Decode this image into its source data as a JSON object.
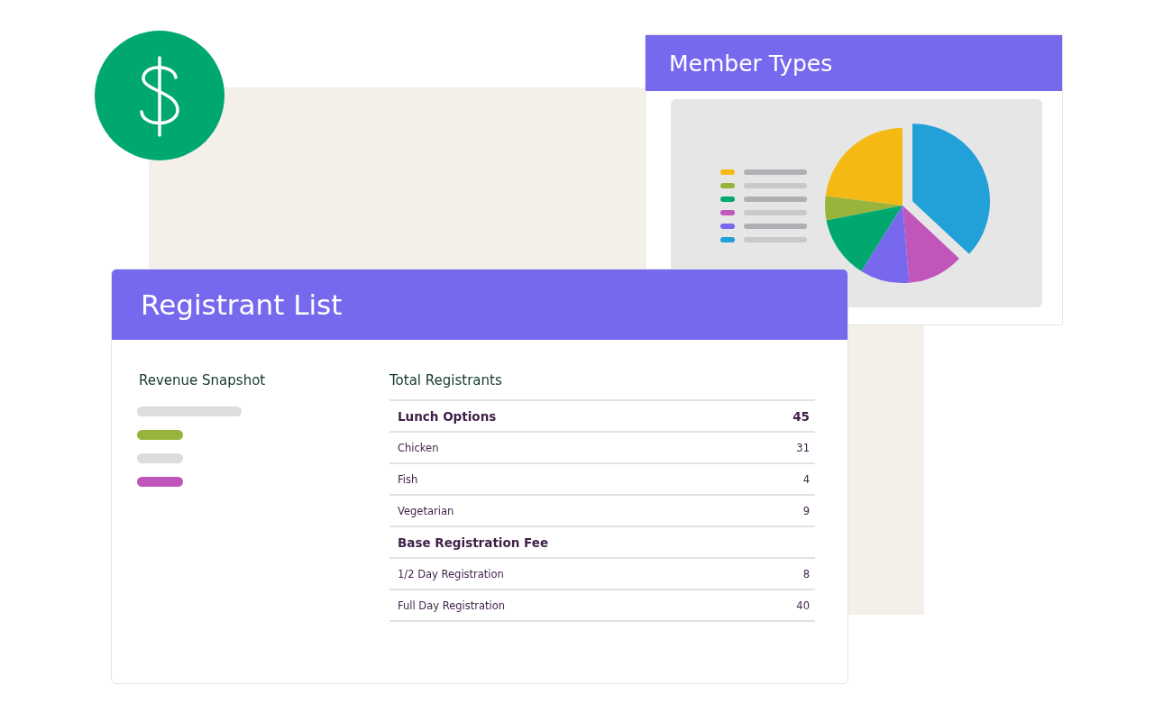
{
  "member_types": {
    "title": "Member Types",
    "legend": [
      {
        "color": "#f5b914"
      },
      {
        "color": "#98b43a"
      },
      {
        "color": "#00a870"
      },
      {
        "color": "#c056ba"
      },
      {
        "color": "#7868ee"
      },
      {
        "color": "#22a0d8"
      }
    ]
  },
  "registrant_list": {
    "title": "Registrant List",
    "revenue_snapshot": {
      "title": "Revenue Snapshot",
      "bars": [
        {
          "kind": "wide",
          "color": "#dcdddd"
        },
        {
          "kind": "narrow",
          "color": "#98b43a"
        },
        {
          "kind": "narrow",
          "color": "#dcdddd"
        },
        {
          "kind": "narrow",
          "color": "#c056ba"
        }
      ]
    },
    "total_registrants": {
      "title": "Total Registrants",
      "rows": [
        {
          "kind": "group",
          "label": "Lunch Options",
          "value": "45"
        },
        {
          "kind": "item",
          "label": "Chicken",
          "value": "31"
        },
        {
          "kind": "item",
          "label": "Fish",
          "value": "4"
        },
        {
          "kind": "item",
          "label": "Vegetarian",
          "value": "9"
        },
        {
          "kind": "group",
          "label": "Base Registration Fee"
        },
        {
          "kind": "item",
          "label": "1/2 Day Registration",
          "value": "8"
        },
        {
          "kind": "item",
          "label": "Full Day Registration",
          "value": "40"
        }
      ]
    }
  }
}
